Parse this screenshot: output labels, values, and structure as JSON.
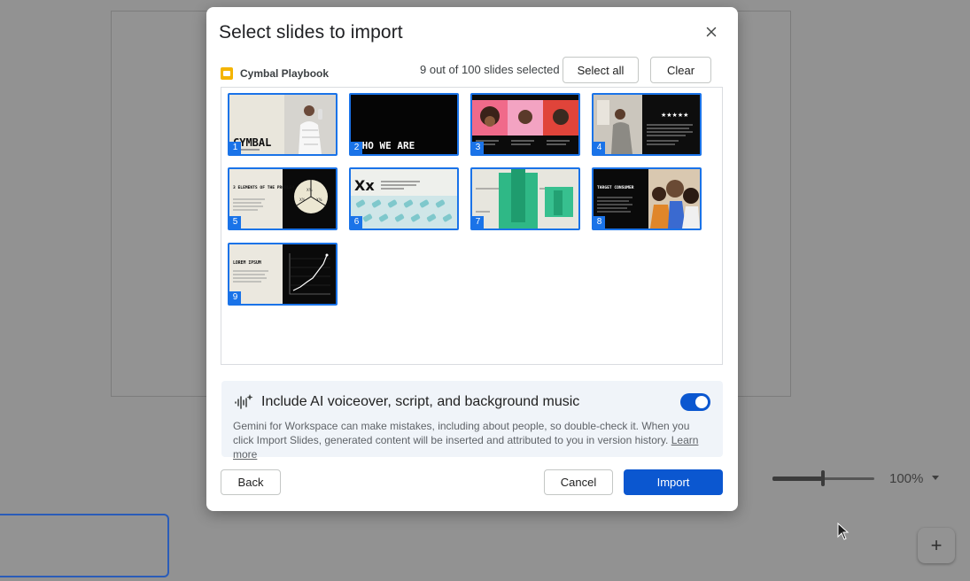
{
  "dialog": {
    "title": "Select slides to import",
    "file_name": "Cymbal Playbook",
    "selection_count": "9 out of 100 slides selected",
    "select_all_label": "Select all",
    "clear_label": "Clear",
    "slides": [
      {
        "number": "1",
        "text": "CYMBAL"
      },
      {
        "number": "2",
        "text": "WHO WE ARE"
      },
      {
        "number": "3"
      },
      {
        "number": "4"
      },
      {
        "number": "5",
        "text": "3 ELEMENTS OF THE PROBLEM"
      },
      {
        "number": "6",
        "text": "Xx"
      },
      {
        "number": "7"
      },
      {
        "number": "8",
        "text": "TARGET CONSUMER"
      },
      {
        "number": "9",
        "text": "LOREM IPSUM"
      }
    ],
    "ai": {
      "title": "Include AI voiceover, script, and background music",
      "toggle_on": true,
      "description": "Gemini for Workspace can make mistakes, including about people, so double-check it. When you click Import Slides, generated content will be inserted and attributed to you in version history.",
      "learn_more": "Learn more"
    },
    "back_label": "Back",
    "cancel_label": "Cancel",
    "import_label": "Import"
  },
  "background": {
    "zoom_value": "100%",
    "zoom_slider_fraction": 0.5
  },
  "colors": {
    "accent": "#1a73e8",
    "primary_button": "#0b57d0",
    "scrim": "#929292"
  }
}
